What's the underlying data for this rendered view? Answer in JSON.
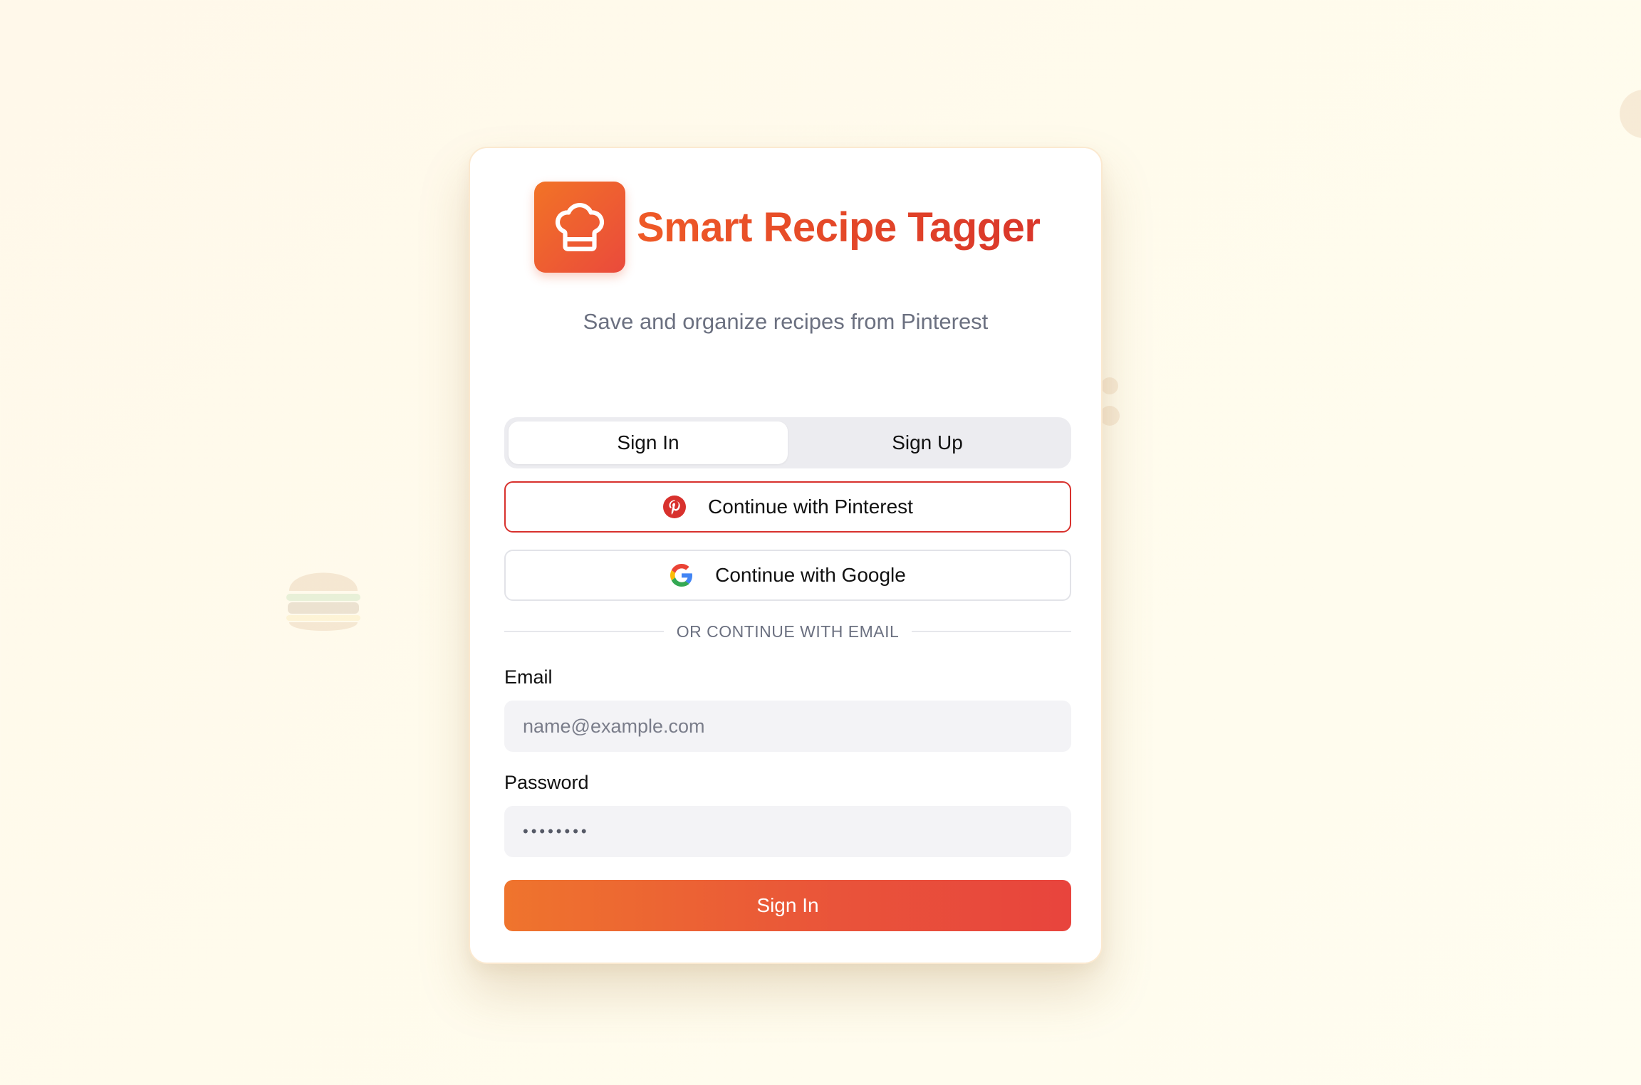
{
  "app": {
    "title": "Smart Recipe Tagger",
    "subtitle": "Save and organize recipes from Pinterest",
    "logo_icon": "chef-hat-icon"
  },
  "tabs": [
    {
      "label": "Sign In",
      "active": true
    },
    {
      "label": "Sign Up",
      "active": false
    }
  ],
  "oauth": {
    "pinterest_label": "Continue with Pinterest",
    "google_label": "Continue with Google"
  },
  "divider_label": "OR CONTINUE WITH EMAIL",
  "form": {
    "email_label": "Email",
    "email_placeholder": "name@example.com",
    "email_value": "",
    "password_label": "Password",
    "password_value": "••••••••"
  },
  "submit_label": "Sign In",
  "colors": {
    "accent_start": "#f27326",
    "accent_end": "#e8443d",
    "pinterest": "#d8312d"
  }
}
